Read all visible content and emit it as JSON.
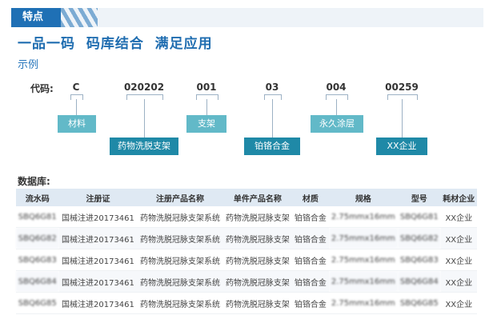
{
  "header": {
    "tab": "特点"
  },
  "title": "一品一码  码库结合  满足应用",
  "example_label": "示例",
  "code": {
    "label": "代码:",
    "segments": [
      {
        "code": "C",
        "tag": "材料"
      },
      {
        "code": "020202",
        "tag": "药物洗脱支架"
      },
      {
        "code": "001",
        "tag": "支架"
      },
      {
        "code": "03",
        "tag": "铂铬合金"
      },
      {
        "code": "004",
        "tag": "永久涂层"
      },
      {
        "code": "00259",
        "tag": "XX企业"
      }
    ]
  },
  "database": {
    "label": "数据库:",
    "columns": [
      "流水码",
      "注册证",
      "注册产品名称",
      "单件产品名称",
      "材质",
      "规格",
      "型号",
      "耗材企业"
    ],
    "rows": [
      [
        "SBQ6G81",
        "国械注进20173461",
        "药物洗脱冠脉支架系统",
        "药物洗脱冠脉支架",
        "铂铬合金",
        "2.75mmx16mm",
        "SBQ6G81",
        "XX企业"
      ],
      [
        "SBQ6G82",
        "国械注进20173461",
        "药物洗脱冠脉支架系统",
        "药物洗脱冠脉支架",
        "铂铬合金",
        "2.75mmx16mm",
        "SBQ6G82",
        "XX企业"
      ],
      [
        "SBQ6G83",
        "国械注进20173461",
        "药物洗脱冠脉支架系统",
        "药物洗脱冠脉支架",
        "铂铬合金",
        "2.75mmx16mm",
        "SBQ6G83",
        "XX企业"
      ],
      [
        "SBQ6G84",
        "国械注进20173461",
        "药物洗脱冠脉支架系统",
        "药物洗脱冠脉支架",
        "铂铬合金",
        "2.75mmx16mm",
        "SBQ6G84",
        "XX企业"
      ],
      [
        "SBQ6G85",
        "国械注进20173461",
        "药物洗脱冠脉支架系统",
        "药物洗脱冠脉支架",
        "铂铬合金",
        "2.75mmx16mm",
        "SBQ6G85",
        "XX企业"
      ]
    ]
  }
}
